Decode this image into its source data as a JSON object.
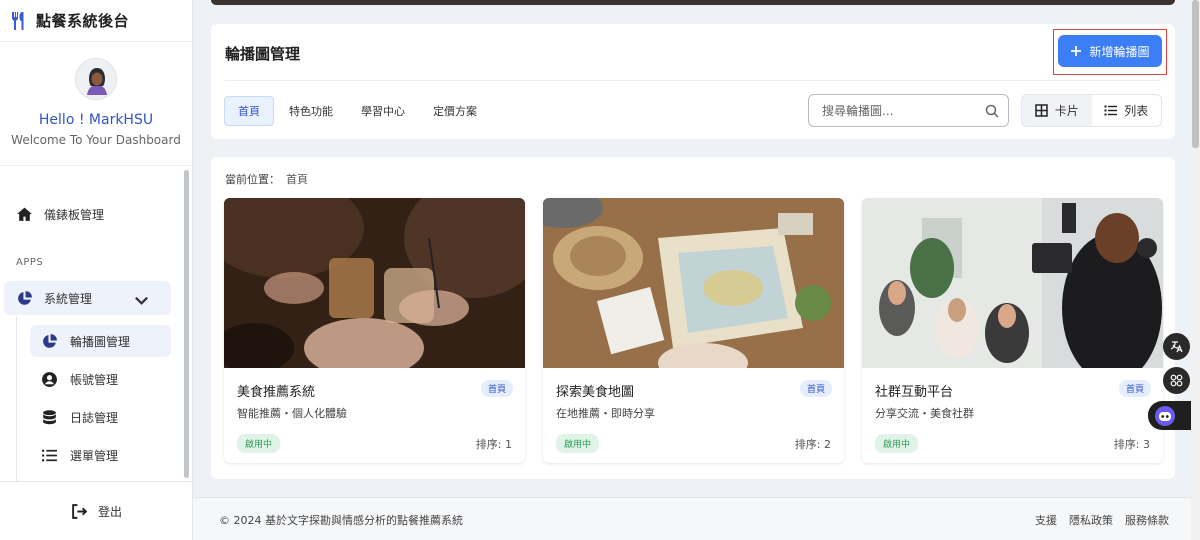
{
  "app": {
    "title": "點餐系統後台"
  },
  "user": {
    "greeting": "Hello ! MarkHSU",
    "welcome": "Welcome To Your Dashboard"
  },
  "sidebar": {
    "dashboard": "儀錶板管理",
    "section": "APPS",
    "system": "系統管理",
    "sub": [
      "輪播圖管理",
      "帳號管理",
      "日誌管理",
      "選單管理"
    ],
    "logout": "登出"
  },
  "panel": {
    "title": "輪播圖管理",
    "add_button": "新增輪播圖",
    "tabs": [
      "首頁",
      "特色功能",
      "學習中心",
      "定價方案"
    ],
    "search_placeholder": "搜尋輪播圖...",
    "view_card": "卡片",
    "view_list": "列表"
  },
  "breadcrumb": {
    "label": "當前位置：",
    "current": "首頁"
  },
  "cards": [
    {
      "title": "美食推薦系統",
      "subtitle": "智能推薦・個人化體驗",
      "tag": "首頁",
      "status": "啟用中",
      "order": "排序: 1"
    },
    {
      "title": "探索美食地圖",
      "subtitle": "在地推薦・即時分享",
      "tag": "首頁",
      "status": "啟用中",
      "order": "排序: 2"
    },
    {
      "title": "社群互動平台",
      "subtitle": "分享交流・美食社群",
      "tag": "首頁",
      "status": "啟用中",
      "order": "排序: 3"
    }
  ],
  "footer": {
    "copyright": "© 2024 基於文字探勘與情感分析的點餐推薦系統",
    "links": [
      "支援",
      "隱私政策",
      "服務條款"
    ]
  },
  "colors": {
    "accent": "#3b7ef5",
    "brand": "#2f55c9",
    "status_green": "#2e9b58"
  },
  "icons": [
    "fork-knife-icon",
    "home-icon",
    "pie-chart-icon",
    "chevron-down-icon",
    "user-icon",
    "database-icon",
    "list-icon",
    "logout-icon",
    "plus-icon",
    "search-icon",
    "grid-icon",
    "translate-icon",
    "apps-icon",
    "bot-icon"
  ]
}
